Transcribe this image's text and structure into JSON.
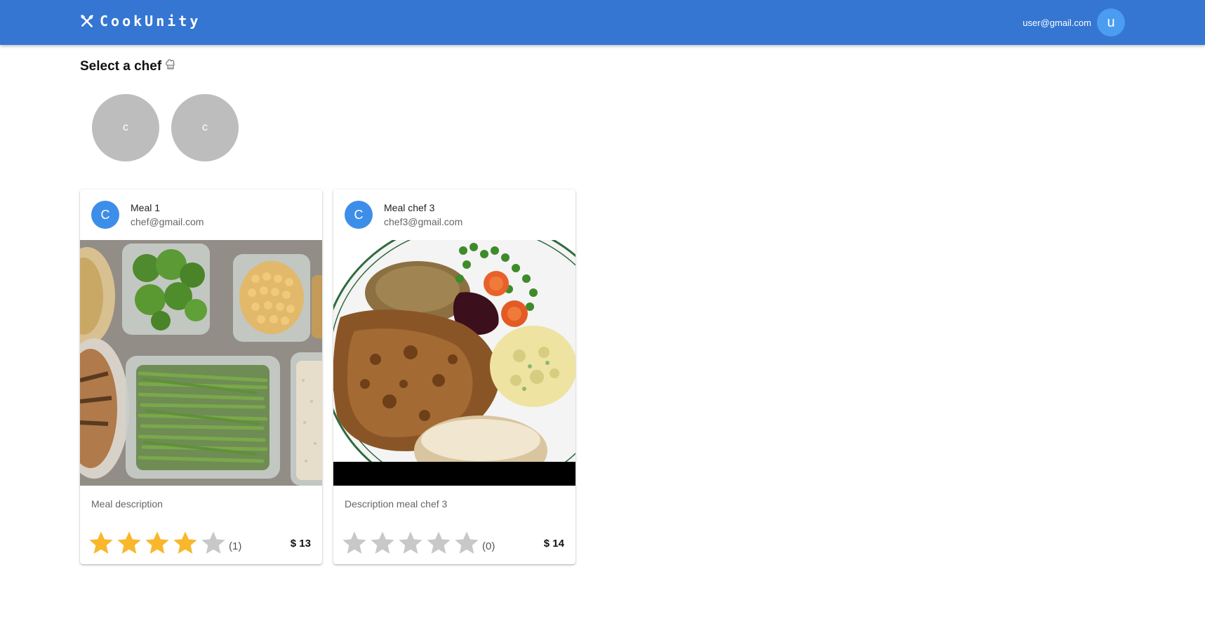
{
  "header": {
    "brand": "CookUnity",
    "user_email": "user@gmail.com",
    "user_initial": "u"
  },
  "chef_selector": {
    "title": "Select a chef",
    "icon": "chef-hat-icon",
    "chefs": [
      {
        "initial": "c"
      },
      {
        "initial": "c"
      }
    ]
  },
  "meals": [
    {
      "avatar_initial": "C",
      "title": "Meal 1",
      "chef_email": "chef@gmail.com",
      "image": "meal-prep-containers-image",
      "description": "Meal description",
      "rating": 4,
      "rating_count": "(1)",
      "price": "$ 13"
    },
    {
      "avatar_initial": "C",
      "title": "Meal chef 3",
      "chef_email": "chef3@gmail.com",
      "image": "fried-chicken-plate-image",
      "description": "Description meal chef 3",
      "rating": 0,
      "rating_count": "(0)",
      "price": "$ 14"
    }
  ],
  "colors": {
    "appbar": "#3476d2",
    "star_filled": "#f9b72c",
    "star_empty": "#c8c8c8",
    "avatar": "#3d8ee8"
  }
}
